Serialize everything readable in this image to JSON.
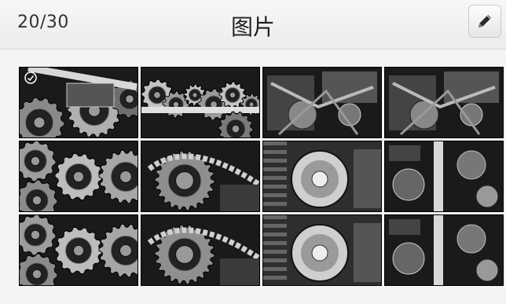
{
  "header": {
    "counter": "20/30",
    "title": "图片",
    "edit_icon": "pencil-icon"
  },
  "gallery": {
    "selected_index": 0,
    "items": [
      {
        "motif": "gears-rod"
      },
      {
        "motif": "gearbox"
      },
      {
        "motif": "engine-bay"
      },
      {
        "motif": "engine-bay"
      },
      {
        "motif": "gear-train"
      },
      {
        "motif": "timing-chain"
      },
      {
        "motif": "pulley"
      },
      {
        "motif": "engine-belt"
      },
      {
        "motif": "gear-train"
      },
      {
        "motif": "timing-chain"
      },
      {
        "motif": "pulley"
      },
      {
        "motif": "engine-belt"
      }
    ]
  }
}
